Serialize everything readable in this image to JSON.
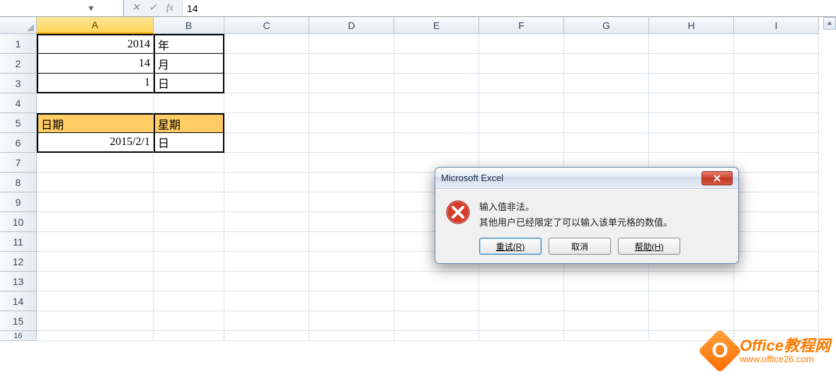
{
  "formula_bar": {
    "name_box": "",
    "fx_label": "fx",
    "value": "14"
  },
  "columns": [
    "A",
    "B",
    "C",
    "D",
    "E",
    "F",
    "G",
    "H",
    "I"
  ],
  "selected_column": "A",
  "rows": [
    {
      "n": "1",
      "A": "2014",
      "B": "年"
    },
    {
      "n": "2",
      "A": "14",
      "B": "月"
    },
    {
      "n": "3",
      "A": "1",
      "B": "日"
    },
    {
      "n": "4",
      "A": "",
      "B": ""
    },
    {
      "n": "5",
      "A": "日期",
      "B": "星期"
    },
    {
      "n": "6",
      "A": "2015/2/1",
      "B": "日"
    },
    {
      "n": "7",
      "A": "",
      "B": ""
    },
    {
      "n": "8",
      "A": "",
      "B": ""
    },
    {
      "n": "9",
      "A": "",
      "B": ""
    },
    {
      "n": "10",
      "A": "",
      "B": ""
    },
    {
      "n": "11",
      "A": "",
      "B": ""
    },
    {
      "n": "12",
      "A": "",
      "B": ""
    },
    {
      "n": "13",
      "A": "",
      "B": ""
    },
    {
      "n": "14",
      "A": "",
      "B": ""
    },
    {
      "n": "15",
      "A": "",
      "B": ""
    },
    {
      "n": "16",
      "A": "",
      "B": ""
    }
  ],
  "dialog": {
    "title": "Microsoft Excel",
    "line1": "输入值非法。",
    "line2": "其他用户已经限定了可以输入该单元格的数值。",
    "retry": "重试(R)",
    "cancel": "取消",
    "help": "帮助(H)"
  },
  "watermark": {
    "logo_letter": "O",
    "title": "Office教程网",
    "url": "www.office26.com"
  }
}
